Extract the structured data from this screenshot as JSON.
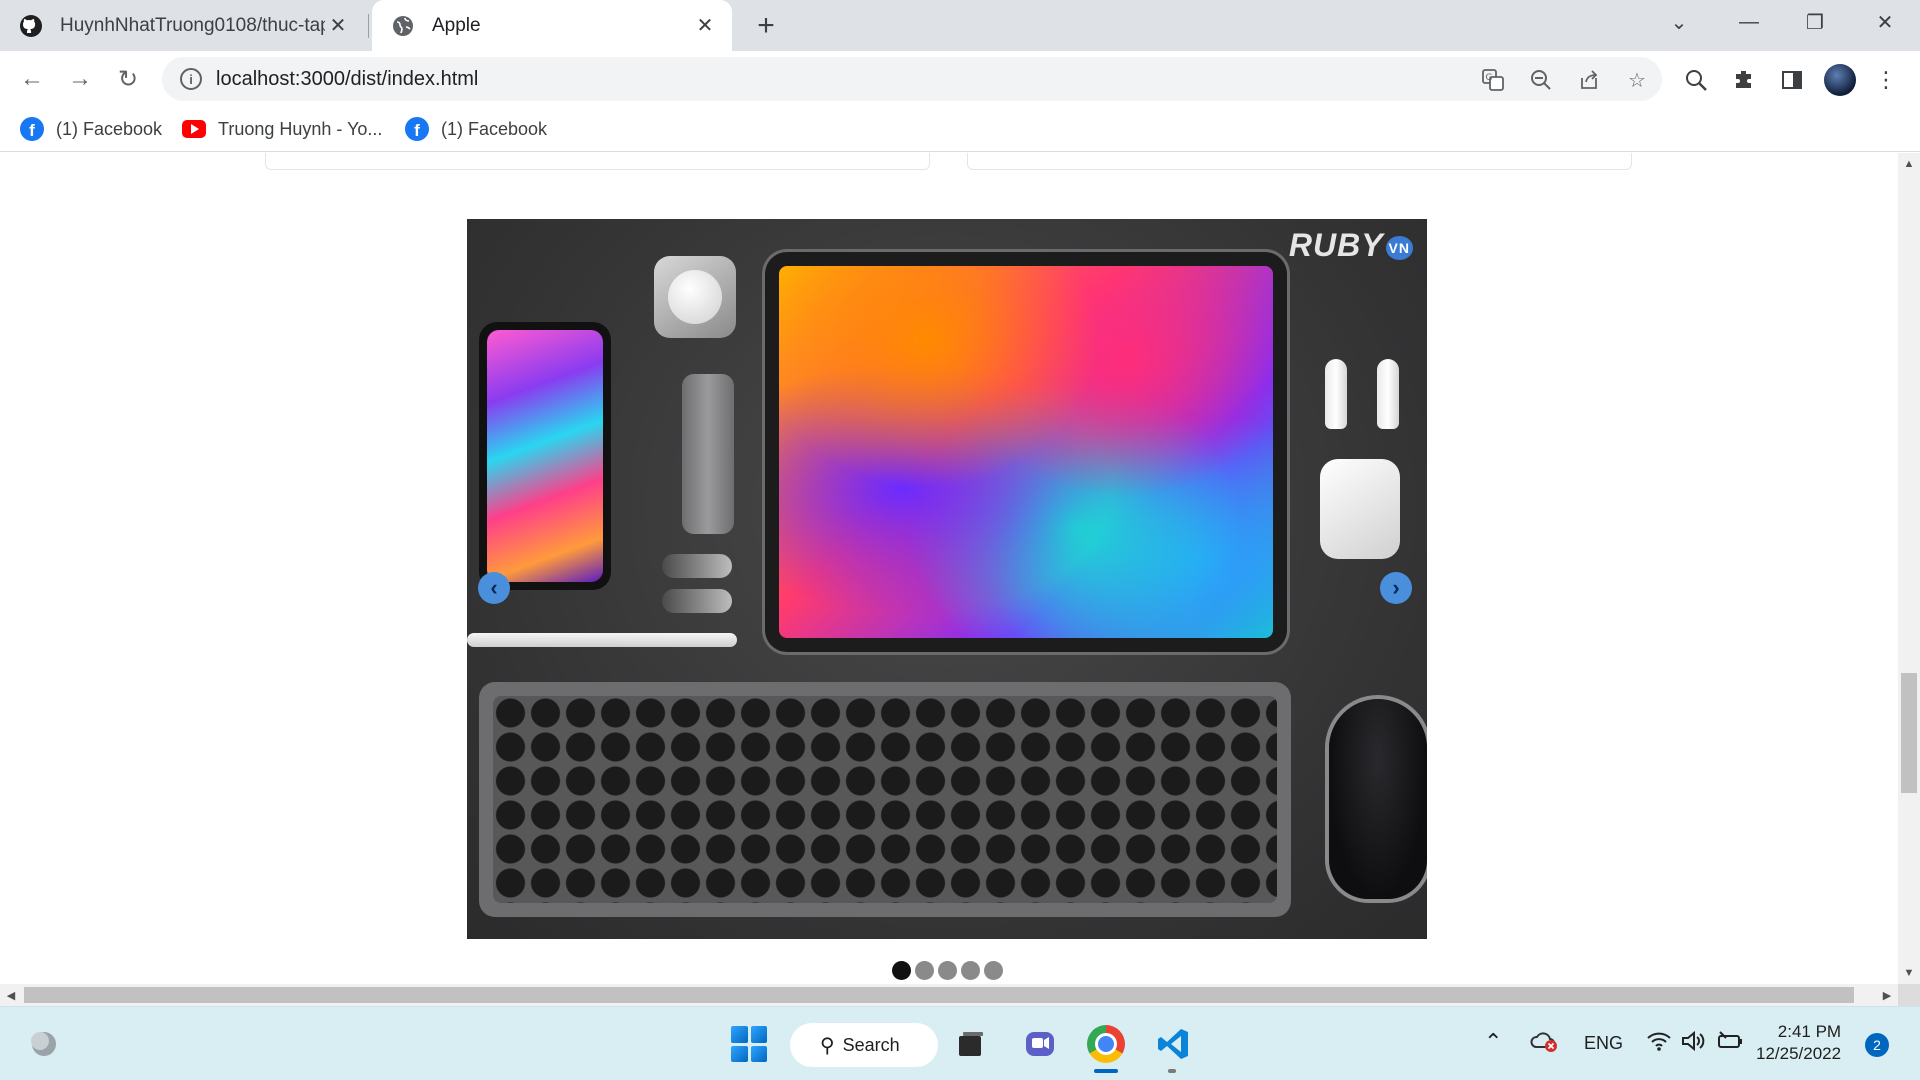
{
  "browser": {
    "tabs": [
      {
        "title": "HuynhNhatTruong0108/thuc-tap",
        "icon": "github-icon",
        "active": false
      },
      {
        "title": "Apple",
        "icon": "globe-icon",
        "active": true
      }
    ],
    "address": "localhost:3000/dist/index.html",
    "bookmarks": [
      {
        "label": "(1) Facebook",
        "icon": "facebook-icon"
      },
      {
        "label": "Truong Huynh - Yo...",
        "icon": "youtube-icon"
      },
      {
        "label": "(1) Facebook",
        "icon": "facebook-icon"
      }
    ]
  },
  "page": {
    "slider": {
      "watermark": "RUBY",
      "watermark_suffix": "VN",
      "slide_count": 5,
      "active_index": 0
    }
  },
  "taskbar": {
    "search_label": "Search",
    "language": "ENG",
    "time": "2:41 PM",
    "date": "12/25/2022",
    "notification_count": "2"
  },
  "colors": {
    "tabstrip": "#dee1e6",
    "taskbar": "#d8eef2",
    "slider_arrow": "#4a8fdb",
    "active_dot": "#111111"
  }
}
